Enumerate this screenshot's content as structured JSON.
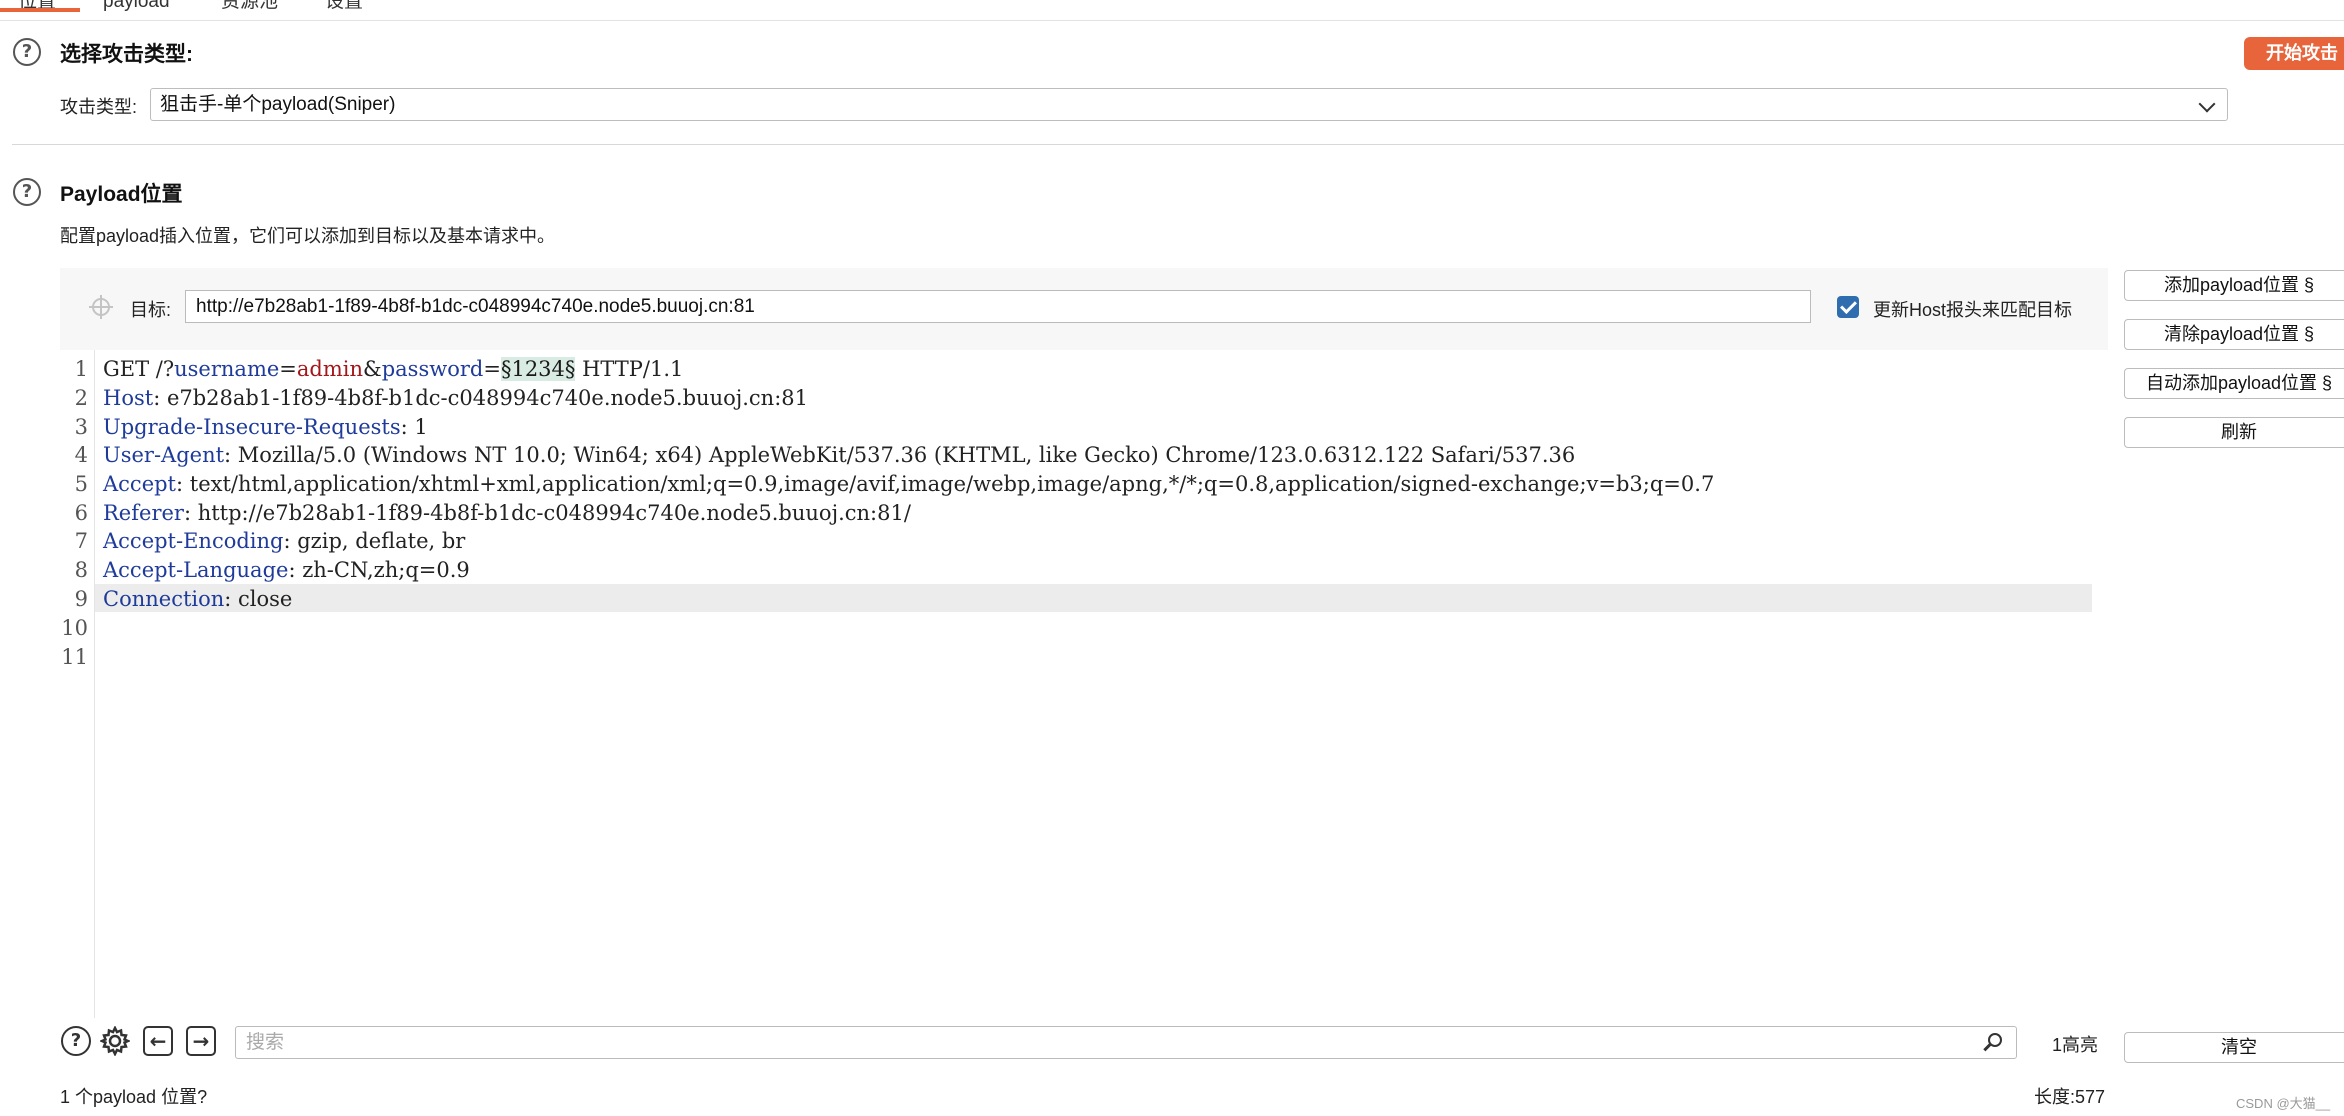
{
  "tabs": [
    "位置",
    "payload",
    "资源池",
    "设置"
  ],
  "attack_type": {
    "title": "选择攻击类型:",
    "label": "攻击类型:",
    "selected": "狙击手-单个payload(Sniper)",
    "start_button": "开始攻击"
  },
  "positions": {
    "title": "Payload位置",
    "description": "配置payload插入位置，它们可以添加到目标以及基本请求中。",
    "target_label": "目标:",
    "target_value": "http://e7b28ab1-1f89-4b8f-b1dc-c048994c740e.node5.buuoj.cn:81",
    "update_host_label": "更新Host报头来匹配目标",
    "update_host_checked": true
  },
  "side_buttons": {
    "add": "添加payload位置 §",
    "clear": "清除payload位置 §",
    "auto": "自动添加payload位置 §",
    "refresh": "刷新",
    "clear_all": "清空"
  },
  "request": {
    "line_numbers": [
      "1",
      "2",
      "3",
      "4",
      "5",
      "6",
      "7",
      "8",
      "9",
      "10",
      "11"
    ],
    "line1": {
      "method": "GET /?",
      "p1_key": "username",
      "eq1": "=",
      "p1_val": "admin",
      "amp": "&",
      "p2_key": "password",
      "eq2": "=",
      "marker": "§1234§",
      "proto": " HTTP/1.1"
    },
    "headers": [
      {
        "key": "Host",
        "value": ": e7b28ab1-1f89-4b8f-b1dc-c048994c740e.node5.buuoj.cn:81"
      },
      {
        "key": "Upgrade-Insecure-Requests",
        "value": ": 1"
      },
      {
        "key": "User-Agent",
        "value": ": Mozilla/5.0 (Windows NT 10.0; Win64; x64) AppleWebKit/537.36 (KHTML, like Gecko) Chrome/123.0.6312.122 Safari/537.36"
      },
      {
        "key": "Accept",
        "value": ": text/html,application/xhtml+xml,application/xml;q=0.9,image/avif,image/webp,image/apng,*/*;q=0.8,application/signed-exchange;v=b3;q=0.7"
      },
      {
        "key": "Referer",
        "value": ": http://e7b28ab1-1f89-4b8f-b1dc-c048994c740e.node5.buuoj.cn:81/"
      },
      {
        "key": "Accept-Encoding",
        "value": ": gzip, deflate, br"
      },
      {
        "key": "Accept-Language",
        "value": ": zh-CN,zh;q=0.9"
      },
      {
        "key": "Connection",
        "value": ": close"
      }
    ]
  },
  "bottom": {
    "search_placeholder": "搜索",
    "highlight_count": "1高亮",
    "payload_count": "1 个payload 位置?",
    "length": "长度:577",
    "watermark": "CSDN @大猫__"
  },
  "colors": {
    "accent": "#e8643b",
    "header_key": "#1f3b9a",
    "param_value": "#a3161a",
    "marker_bg": "#d9ece3",
    "checkbox": "#2f6dae"
  }
}
